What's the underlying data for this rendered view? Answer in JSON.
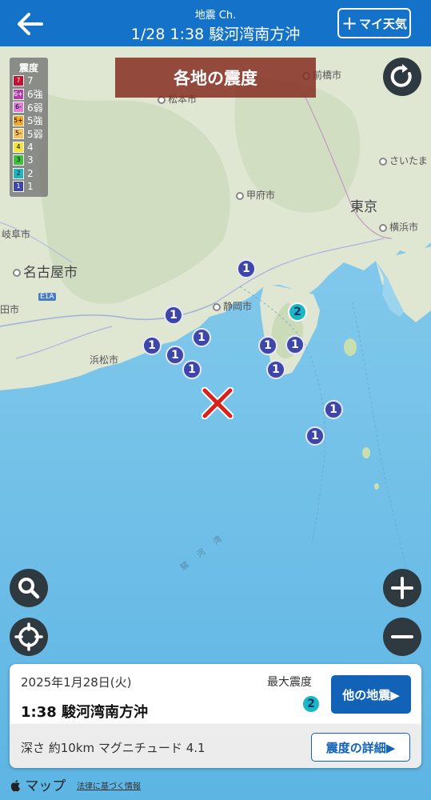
{
  "header": {
    "channel": "地震 Ch.",
    "title": "1/28 1:38 駿河湾南方沖",
    "my_weather_label": "マイ天気",
    "color": "#1473c8"
  },
  "legend": {
    "title": "震度",
    "items": [
      {
        "code": "7",
        "label": "7",
        "color": "#c8102e"
      },
      {
        "code": "6+",
        "label": "6強",
        "color": "#b33ea8"
      },
      {
        "code": "6-",
        "label": "6弱",
        "color": "#e07fd8"
      },
      {
        "code": "5+",
        "label": "5強",
        "color": "#f5a623"
      },
      {
        "code": "5-",
        "label": "5弱",
        "color": "#f7c25a"
      },
      {
        "code": "4",
        "label": "4",
        "color": "#f5e23a"
      },
      {
        "code": "3",
        "label": "3",
        "color": "#3cbf3c"
      },
      {
        "code": "2",
        "label": "2",
        "color": "#1ab6c2"
      },
      {
        "code": "1",
        "label": "1",
        "color": "#3e47a8"
      }
    ]
  },
  "banner": "各地の震度",
  "places": {
    "maebashi": "前橋市",
    "matsumoto": "松本市",
    "saitama": "さいたま",
    "kofu": "甲府市",
    "tokyo": "東京",
    "yokohama": "横浜市",
    "gifu": "岐阜市",
    "nagoya": "名古屋市",
    "city_left": "田市",
    "shizuoka": "静岡市",
    "hamamatsu": "浜松市",
    "e1a": "E1A",
    "suruga_bay": "駿河湾"
  },
  "intensity_markers": [
    {
      "name": "marker-1",
      "value": "1"
    },
    {
      "name": "marker-2",
      "value": "2"
    }
  ],
  "info": {
    "date": "2025年1月28日(火)",
    "place": "1:38 駿河湾南方沖",
    "max_label": "最大震度",
    "max_value": "2",
    "other_button": "他の地震▶",
    "depth_magnitude": "深さ 約10km マグニチュード 4.1",
    "detail_button": "震度の詳細▶"
  },
  "footer": {
    "maps_label": "マップ",
    "legal_link": "法律に基づく情報"
  },
  "map_colors": {
    "sea": "#7ec6ea",
    "land": "#dfe7d6",
    "epicenter": "#d9201a"
  }
}
